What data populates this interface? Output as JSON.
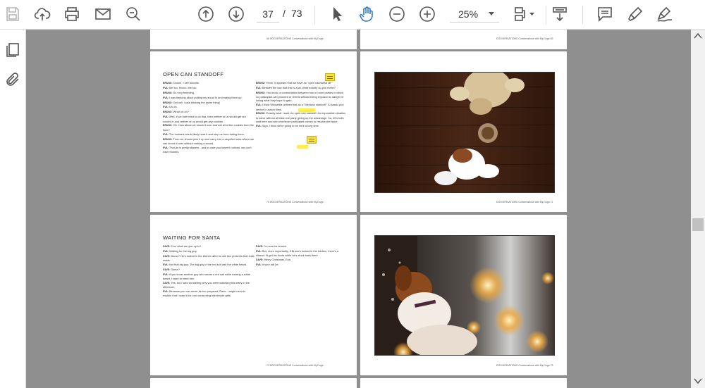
{
  "toolbar": {
    "page_current": "37",
    "page_separator": "/",
    "page_total": "73",
    "zoom_level": "25%"
  },
  "pages": {
    "p68": {
      "header": "68   DOGVERSATIONS Conversations with My Dogs"
    },
    "p69": {
      "header": "DOGVERSATIONS Conversations with My Dogs   69"
    },
    "p70": {
      "chapter_title": "OPEN CAN STANDOFF",
      "left_lines": [
        {
          "speaker": "BRUNO:",
          "text": "Ooooh, I see biscuits."
        },
        {
          "speaker": "EVA:",
          "text": "Me too, Bruno. Me too."
        },
        {
          "speaker": "BRUNO:",
          "text": "So very tempting."
        },
        {
          "speaker": "EVA:",
          "text": "I was thinking about putting my snout in and eating them up."
        },
        {
          "speaker": "BRUNO:",
          "text": "Get out! I was thinking the same thing!"
        },
        {
          "speaker": "EVA:",
          "text": "Uh-oh."
        },
        {
          "speaker": "BRUNO:",
          "text": "What uh-oh?"
        },
        {
          "speaker": "EVA:",
          "text": "Well, if we both tried to do that, then neither of us would get our snouts in and neither of us would get any cookies."
        },
        {
          "speaker": "BRUNO:",
          "text": "Oh. How about we knock it over and eat all of the cookies from the floor?"
        },
        {
          "speaker": "EVA:",
          "text": "The humans would likely hear it and stop us from eating them."
        },
        {
          "speaker": "BRUNO:",
          "text": "Then we should pick it up and carry it to a carpeted area where we can knock it over without making a sound."
        },
        {
          "speaker": "EVA:",
          "text": "That jar is pretty slippery - and in case you haven't noticed, we don't have thumbs."
        }
      ],
      "right_lines": [
        {
          "speaker": "BRUNO:",
          "text": "Hmm. It appears that we have an \"open can/stand off.\""
        },
        {
          "speaker": "EVA:",
          "text": "Besides the fact that this is a jar, what exactly do you mean?"
        },
        {
          "speaker": "BRUNO:",
          "text": "You know, a confrontation between two or more parties in which no participant can proceed or retreat without being exposed to danger or losing what they hope to gain."
        },
        {
          "speaker": "EVA:",
          "text": "I think Wikipedia defines that as a \"Mexican standoff.\" A classic plot device in action films."
        },
        {
          "speaker": "BRUNO:",
          "text": "Exactly what I said. An open can standoff. An impossible situation to solve without at least one party giving up the advantage. So, let's both wait here and see whichever participant comes to resolve the issue."
        },
        {
          "speaker": "EVA:",
          "text": "Sigh. I think we're going to be here a long time."
        }
      ],
      "footer": "70   DOGVERSATIONS Conversations with My Dogs"
    },
    "p71": {
      "footer": "DOGVERSATIONS Conversations with My Dogs   71"
    },
    "p72": {
      "chapter_title": "WAITING FOR SANTA",
      "left_lines": [
        {
          "speaker": "DAVE:",
          "text": "Eva, what are you up to?"
        },
        {
          "speaker": "EVA:",
          "text": "Waiting for the big guy."
        },
        {
          "speaker": "DAVE:",
          "text": "Bruno? He's locked in the kitchen after he ate two presents that Julia made."
        },
        {
          "speaker": "EVA:",
          "text": "Not that big guy. The big guy in the red suit and the white beard."
        },
        {
          "speaker": "DAVE:",
          "text": "Santa?"
        },
        {
          "speaker": "EVA:",
          "text": "If you know another guy who wears a red suit while rocking a white beard, I want to meet him."
        },
        {
          "speaker": "DAVE:",
          "text": "Yes, but I was wondering why you were watching this early in the afternoon."
        },
        {
          "speaker": "EVA:",
          "text": "Because you can never be too prepared, Dave. I might need to explain that I wasn't the one consuming handmade gifts."
        }
      ],
      "right_lines": [
        {
          "speaker": "DAVE:",
          "text": "I'm sure he knows."
        },
        {
          "speaker": "EVA:",
          "text": "But, more importantly, if Bruno's locked in the kitchen, there's a chance I'll get his boots while he's stuck back there."
        },
        {
          "speaker": "DAVE:",
          "text": "Merry Christmas, Eva."
        },
        {
          "speaker": "EVA:",
          "text": "It sure will be."
        }
      ],
      "footer": "72   DOGVERSATIONS Conversations with My Dogs"
    },
    "p73": {
      "footer": "DOGVERSATIONS Conversations with My Dogs   73"
    }
  },
  "colors": {
    "viewer_bg": "#8f8f8f",
    "toolbar_bg": "#ffffff",
    "icon": "#555555",
    "note_yellow": "#f7e23c"
  },
  "icons": {
    "toolbar": [
      "save-icon",
      "upload-icon",
      "print-icon",
      "email-icon",
      "search-zoom-icon",
      "arrow-up-circle-icon",
      "arrow-down-circle-icon",
      "select-cursor-icon",
      "hand-tool-icon",
      "zoom-out-icon",
      "zoom-in-icon",
      "page-layout-icon",
      "scroll-mode-icon",
      "comment-icon",
      "highlight-icon",
      "sign-icon"
    ],
    "leftbar": [
      "pages-icon",
      "attachment-icon"
    ]
  }
}
